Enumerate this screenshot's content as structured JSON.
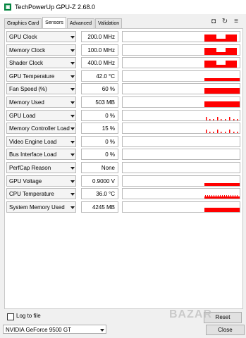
{
  "window": {
    "title": "TechPowerUp GPU-Z 2.68.0"
  },
  "tabs": [
    {
      "label": "Graphics Card"
    },
    {
      "label": "Sensors",
      "active": true
    },
    {
      "label": "Advanced"
    },
    {
      "label": "Validation"
    }
  ],
  "toolbar": {
    "icons": [
      "camera-icon",
      "refresh-icon",
      "menu-icon"
    ]
  },
  "sensors": [
    {
      "label": "GPU Clock",
      "value": "200.0 MHz",
      "graph": "square"
    },
    {
      "label": "Memory Clock",
      "value": "100.0 MHz",
      "graph": "square"
    },
    {
      "label": "Shader Clock",
      "value": "400.0 MHz",
      "graph": "square"
    },
    {
      "label": "GPU Temperature",
      "value": "42.0 °C",
      "graph": "low"
    },
    {
      "label": "Fan Speed (%)",
      "value": "60 %",
      "graph": "high"
    },
    {
      "label": "Memory Used",
      "value": "503 MB",
      "graph": "high"
    },
    {
      "label": "GPU Load",
      "value": "0 %",
      "graph": "spikes"
    },
    {
      "label": "Memory Controller Load",
      "value": "15 %",
      "graph": "spikes"
    },
    {
      "label": "Video Engine Load",
      "value": "0 %",
      "graph": "none"
    },
    {
      "label": "Bus Interface Load",
      "value": "0 %",
      "graph": "none"
    },
    {
      "label": "PerfCap Reason",
      "value": "None",
      "graph": "none"
    },
    {
      "label": "GPU Voltage",
      "value": "0.9000 V",
      "graph": "low"
    },
    {
      "label": "CPU Temperature",
      "value": "36.0 °C",
      "graph": "noisy"
    },
    {
      "label": "System Memory Used",
      "value": "4245 MB",
      "graph": "mid"
    }
  ],
  "log": {
    "label": "Log to file",
    "checked": false
  },
  "buttons": {
    "reset": "Reset",
    "close": "Close"
  },
  "gpu_select": {
    "value": "NVIDIA GeForce 9500 GT"
  },
  "colors": {
    "graph": "#ff0000"
  }
}
